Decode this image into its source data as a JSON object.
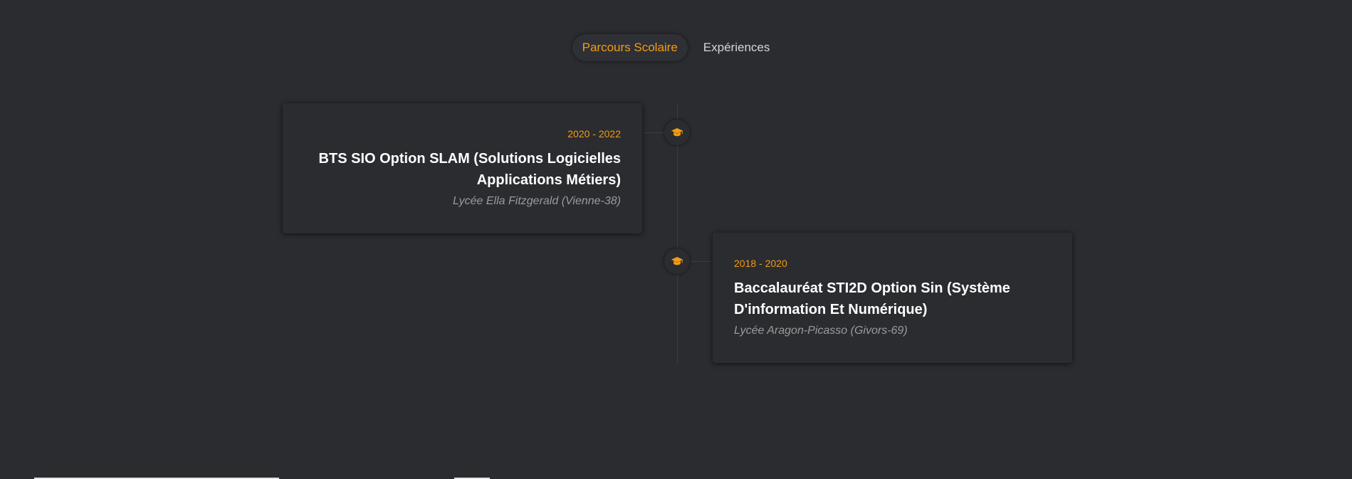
{
  "tabs": [
    {
      "label": "Parcours Scolaire",
      "active": true
    },
    {
      "label": "Expériences",
      "active": false
    }
  ],
  "timeline": [
    {
      "date": "2020 - 2022",
      "title": "BTS SIO Option SLAM (Solutions Logicielles Applications Métiers)",
      "school": "Lycée Ella Fitzgerald (Vienne-38)",
      "side": "left",
      "icon": "graduation-cap-icon"
    },
    {
      "date": "2018 - 2020",
      "title": "Baccalauréat STI2D Option Sin (Système D'information Et Numérique)",
      "school": "Lycée Aragon-Picasso (Givors-69)",
      "side": "right",
      "icon": "graduation-cap-icon"
    }
  ],
  "colors": {
    "background": "#2b2c30",
    "accent": "#f39c12",
    "text": "#ffffff",
    "muted": "#9b9b9b"
  }
}
